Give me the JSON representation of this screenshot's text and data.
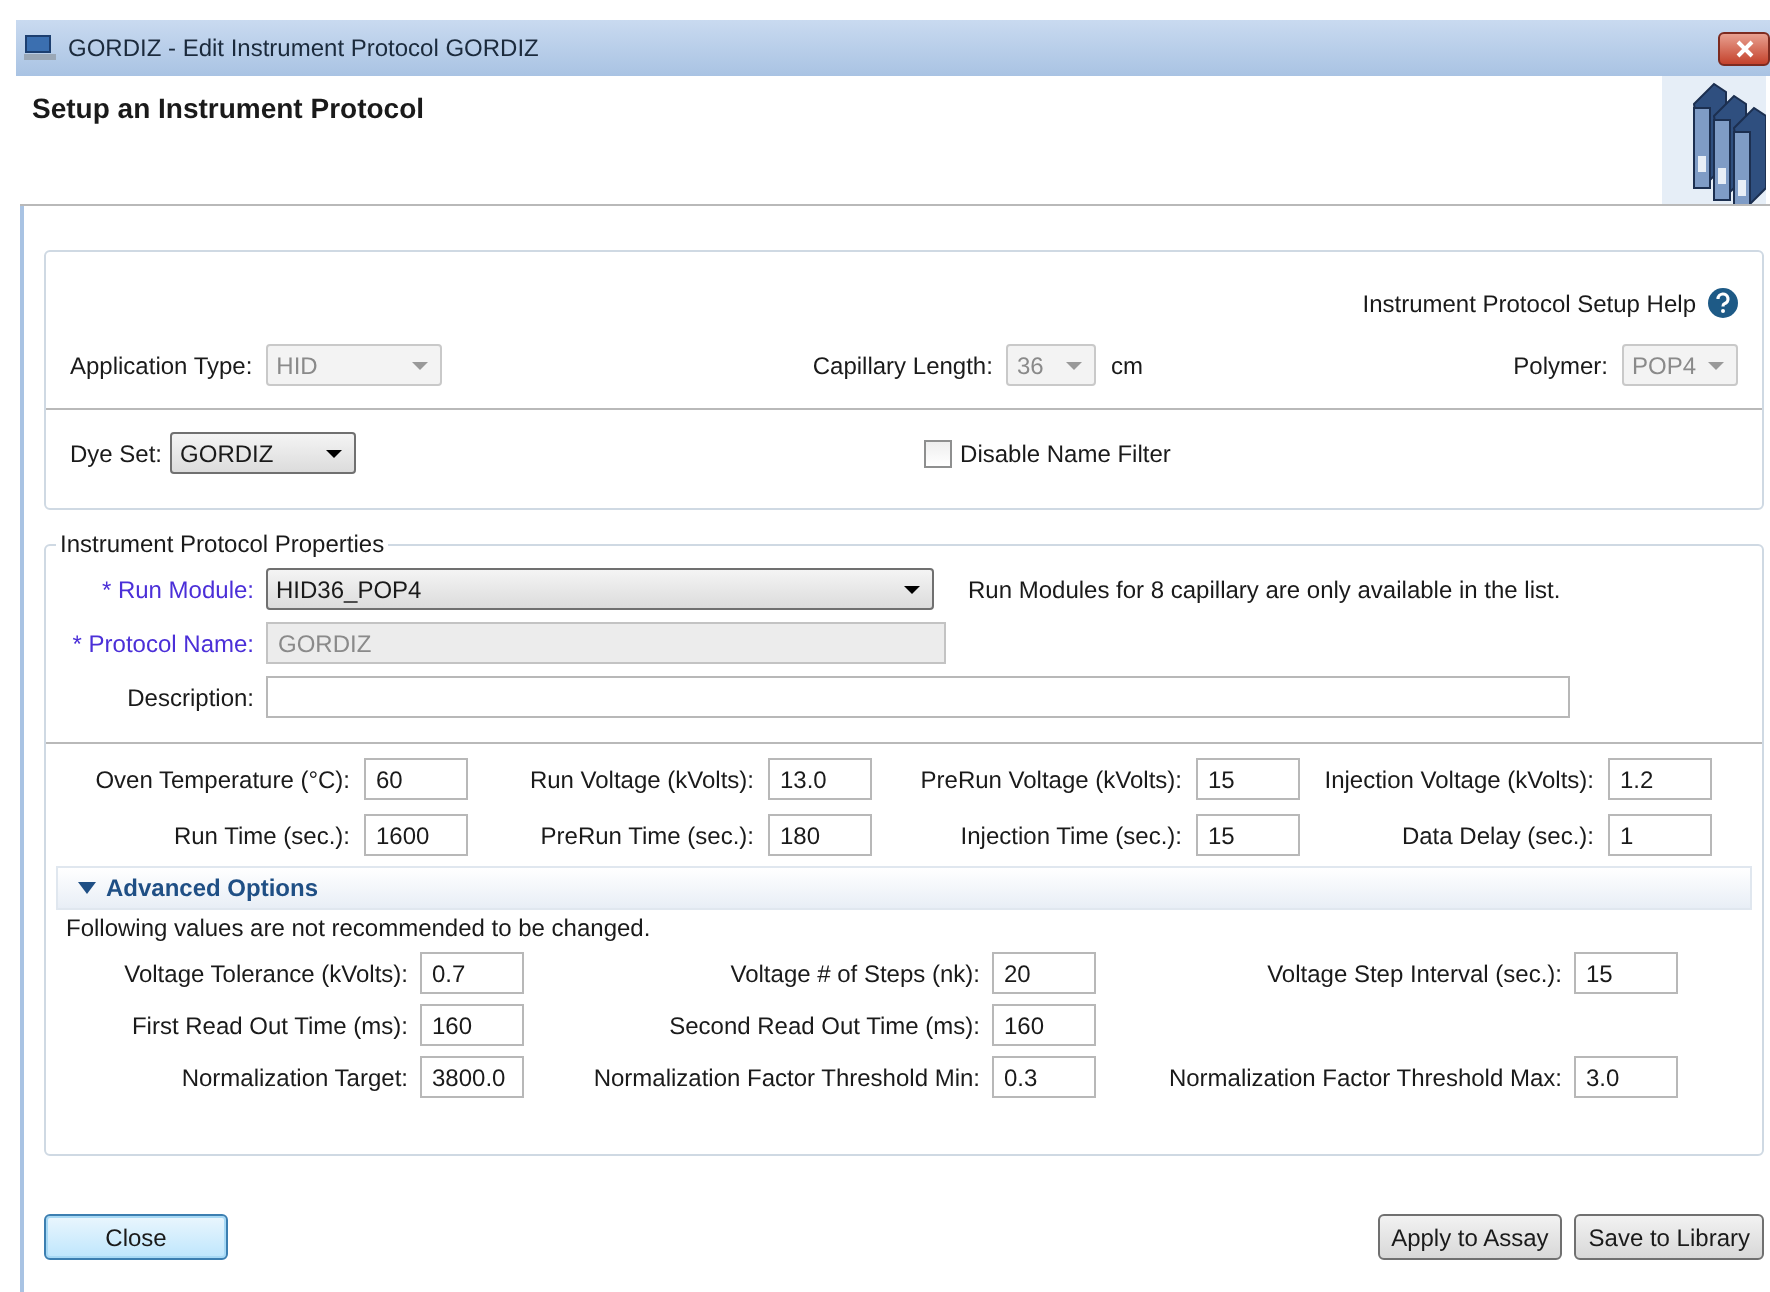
{
  "window": {
    "title": "GORDIZ - Edit Instrument Protocol GORDIZ"
  },
  "header": {
    "title": "Setup an Instrument Protocol"
  },
  "help_link": "Instrument Protocol Setup Help",
  "settings": [
    {
      "label": "Application Type:",
      "value": "HID",
      "disabled": true
    },
    {
      "label": "Capillary Length:",
      "value": "36",
      "disabled": true,
      "unit": "cm"
    },
    {
      "label": "Polymer:",
      "value": "POP4",
      "disabled": true
    }
  ],
  "dye_set": {
    "label": "Dye Set:",
    "value": "GORDIZ",
    "disabled": false
  },
  "name_filter": {
    "label": "Disable Name Filter",
    "checked": false
  },
  "properties": {
    "legend": "Instrument Protocol Properties",
    "run_module": {
      "label": "* Run Module:",
      "value": "HID36_POP4",
      "disabled": false,
      "note": "Run Modules for 8 capillary are only available in the list."
    },
    "protocol_name": {
      "label": "* Protocol Name:",
      "value": "GORDIZ",
      "disabled": true
    },
    "description": {
      "label": "Description:"
    },
    "run_params": [
      [
        {
          "label": "Oven Temperature (°C):",
          "value": "60"
        },
        {
          "label": "Run Voltage (kVolts):",
          "value": "13.0"
        },
        {
          "label": "PreRun Voltage (kVolts):",
          "value": "15"
        },
        {
          "label": "Injection Voltage (kVolts):",
          "value": "1.2"
        }
      ],
      [
        {
          "label": "Run Time (sec.):",
          "value": "1600"
        },
        {
          "label": "PreRun Time (sec.):",
          "value": "180"
        },
        {
          "label": "Injection Time (sec.):",
          "value": "15"
        },
        {
          "label": "Data Delay (sec.):",
          "value": "1"
        }
      ]
    ],
    "advanced": {
      "title": "Advanced Options",
      "expanded": true,
      "note": "Following values are not recommended to be changed.",
      "rows": [
        [
          {
            "label": "Voltage Tolerance (kVolts):",
            "value": "0.7"
          },
          {
            "label": "Voltage # of Steps (nk):",
            "value": "20"
          },
          {
            "label": "Voltage Step Interval (sec.):",
            "value": "15"
          }
        ],
        [
          {
            "label": "First Read Out Time (ms):",
            "value": "160"
          },
          {
            "label": "Second Read Out Time (ms):",
            "value": "160"
          }
        ],
        [
          {
            "label": "Normalization Target:",
            "value": "3800.0"
          },
          {
            "label": "Normalization Factor Threshold Min:",
            "value": "0.3"
          },
          {
            "label": "Normalization Factor Threshold Max:",
            "value": "3.0"
          }
        ]
      ]
    }
  },
  "buttons": [
    {
      "label": "Close",
      "kind": "default"
    },
    {
      "label": "Apply to Assay",
      "kind": "normal"
    },
    {
      "label": "Save to Library",
      "kind": "normal"
    }
  ]
}
